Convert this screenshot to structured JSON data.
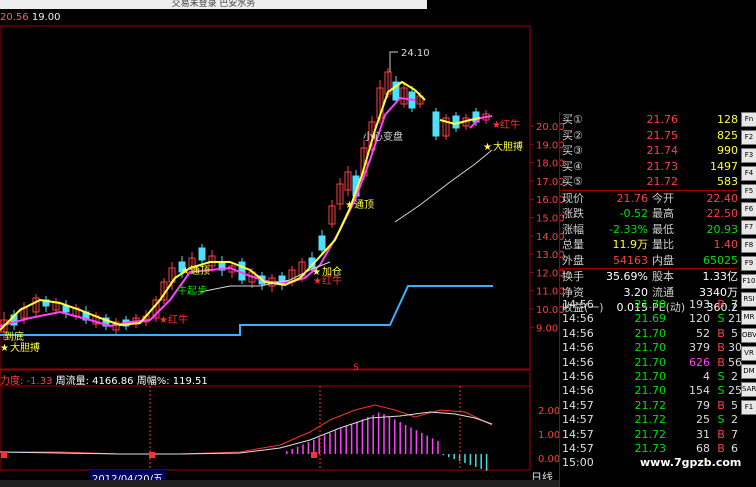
{
  "window": {
    "title": "交易未登录  巴安水务"
  },
  "top_readout": {
    "a": "20.56",
    "b": "19.00"
  },
  "price_axis": [
    "20.00",
    "19.00",
    "18.00",
    "17.00",
    "16.00",
    "15.00",
    "14.00",
    "13.00",
    "12.00",
    "11.00",
    "10.00",
    "9.00"
  ],
  "sub_axis": [
    "2.00",
    "1.00",
    "0.00"
  ],
  "annotations": {
    "peak": "24.10",
    "xiaoxinbianpan": "小心变盘",
    "hongniu": "红牛",
    "dadanbo_top": "大胆搏",
    "tongding": "通顶",
    "jiacang": "加仓",
    "hongniu2": "红牛",
    "niuqibu": "牛起步",
    "tongding2": "通顶",
    "hongniu3": "红牛",
    "dadanbo_bottom": "大胆搏",
    "jicai": "到底",
    "s_marker": "S"
  },
  "indicator_line": {
    "name": "力度: -1.33",
    "flow": "周流量: 4166.86",
    "pct": "周幅%: 119.51"
  },
  "cursor_date": "2012/04/20/五",
  "day_line": "日线",
  "watermark": "www.7gpzb.com",
  "orderbook": {
    "asks": [
      {
        "label": "买①",
        "price": "21.76",
        "vol": "128"
      },
      {
        "label": "买②",
        "price": "21.75",
        "vol": "825"
      },
      {
        "label": "买③",
        "price": "21.74",
        "vol": "990"
      },
      {
        "label": "买④",
        "price": "21.73",
        "vol": "1497"
      },
      {
        "label": "买⑤",
        "price": "21.72",
        "vol": "583"
      }
    ],
    "stats": [
      {
        "l1": "现价",
        "v1": "21.76",
        "l2": "今开",
        "v2": "22.40"
      },
      {
        "l1": "涨跌",
        "v1": "-0.52",
        "l2": "最高",
        "v2": "22.50"
      },
      {
        "l1": "涨幅",
        "v1": "-2.33%",
        "l2": "最低",
        "v2": "20.93"
      },
      {
        "l1": "总量",
        "v1": "11.9万",
        "l2": "量比",
        "v2": "1.40"
      },
      {
        "l1": "外盘",
        "v1": "54163",
        "l2": "内盘",
        "v2": "65025"
      }
    ],
    "stats2": [
      {
        "l1": "换手",
        "v1": "35.69%",
        "l2": "股本",
        "v2": "1.33亿"
      },
      {
        "l1": "净资",
        "v1": "3.20",
        "l2": "流通",
        "v2": "3340万"
      },
      {
        "l1": "收益(一)",
        "v1": "0.015",
        "l2": "PE(动)",
        "v2": "360.2"
      }
    ]
  },
  "ticks": [
    {
      "t": "14:56",
      "p": "21.70",
      "v": "193",
      "s": "B",
      "n": "7"
    },
    {
      "t": "14:56",
      "p": "21.69",
      "v": "120",
      "s": "S",
      "n": "21"
    },
    {
      "t": "14:56",
      "p": "21.70",
      "v": "52",
      "s": "B",
      "n": "5"
    },
    {
      "t": "14:56",
      "p": "21.70",
      "v": "379",
      "s": "B",
      "n": "30"
    },
    {
      "t": "14:56",
      "p": "21.70",
      "v": "626",
      "s": "B",
      "n": "56"
    },
    {
      "t": "14:56",
      "p": "21.70",
      "v": "4",
      "s": "S",
      "n": "2"
    },
    {
      "t": "14:56",
      "p": "21.70",
      "v": "154",
      "s": "S",
      "n": "25"
    },
    {
      "t": "14:57",
      "p": "21.72",
      "v": "79",
      "s": "B",
      "n": "5"
    },
    {
      "t": "14:57",
      "p": "21.72",
      "v": "25",
      "s": "S",
      "n": "2"
    },
    {
      "t": "14:57",
      "p": "21.72",
      "v": "31",
      "s": "B",
      "n": "7"
    },
    {
      "t": "14:57",
      "p": "21.73",
      "v": "68",
      "s": "B",
      "n": "6"
    },
    {
      "t": "15:00",
      "p": "",
      "v": "",
      "s": "",
      "n": ""
    }
  ],
  "toolbar": [
    "Fn",
    "F2",
    "F3",
    "F4",
    "F5",
    "F6",
    "F7",
    "F8",
    "F9",
    "F10",
    "RSI",
    "MR",
    "OBV",
    "VR",
    "DM",
    "SAR",
    "F1"
  ],
  "colors": {
    "up": "#ff4040",
    "down": "#00e000",
    "ma_yellow": "#ffff40",
    "ma_magenta": "#ff40ff",
    "ma_white": "#e0e0e0",
    "base_line": "#3ab0ff"
  }
}
